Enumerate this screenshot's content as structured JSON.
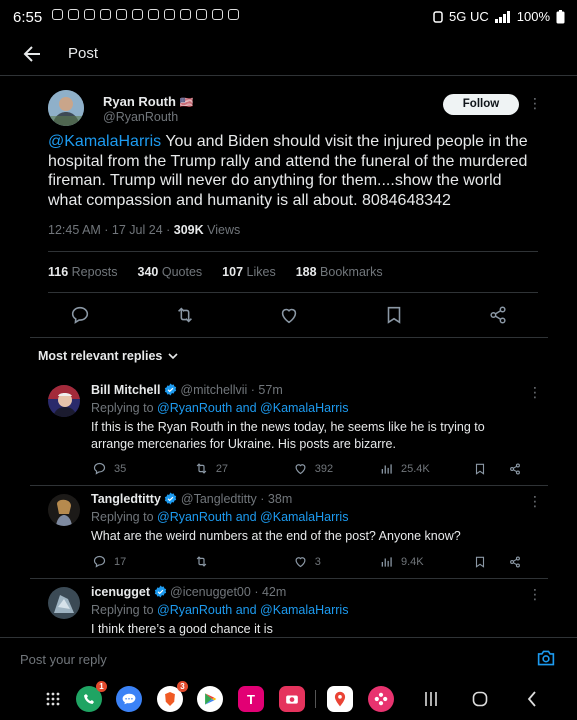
{
  "status_bar": {
    "time": "6:55",
    "network": "5G UC",
    "battery": "100%"
  },
  "header": {
    "title": "Post"
  },
  "post": {
    "author_name": "Ryan Routh",
    "author_flag": "🇺🇸",
    "author_handle": "@RyanRouth",
    "follow_label": "Follow",
    "mention": "@KamalaHarris",
    "text": " You and Biden should visit the injured people in the hospital from the Trump rally and attend the funeral of the murdered fireman. Trump will never do anything for them....show the world what compassion and humanity is all about. 8084648342",
    "time": "12:45 AM · 17 Jul 24 · ",
    "views_count": "309K",
    "views_label": " Views",
    "reposts_count": "116",
    "reposts_label": "Reposts",
    "quotes_count": "340",
    "quotes_label": "Quotes",
    "likes_count": "107",
    "likes_label": "Likes",
    "bookmarks_count": "188",
    "bookmarks_label": "Bookmarks"
  },
  "replies_filter": "Most relevant replies",
  "replies": [
    {
      "name": "Bill Mitchell",
      "handle": "@mitchellvii",
      "age": "· 57m",
      "replying_prefix": "Replying to ",
      "replying_to": "@RyanRouth and @KamalaHarris",
      "text": "If this is the Ryan Routh in the news today, he seems like he is trying to arrange mercenaries for Ukraine. His posts are bizarre.",
      "replies": "35",
      "reposts": "27",
      "likes": "392",
      "views": "25.4K"
    },
    {
      "name": "Tangledtitty",
      "handle": "@Tangledtitty",
      "age": "· 38m",
      "replying_prefix": "Replying to ",
      "replying_to": "@RyanRouth and @KamalaHarris",
      "text": "What are the weird numbers at the end of the post? Anyone know?",
      "replies": "17",
      "reposts": "",
      "likes": "3",
      "views": "9.4K"
    },
    {
      "name": "icenugget",
      "handle": "@icenugget00",
      "age": "· 42m",
      "replying_prefix": "Replying to ",
      "replying_to": "@RyanRouth and @KamalaHarris",
      "text": "I think there’s a good chance it is"
    }
  ],
  "composer": {
    "placeholder": "Post your reply"
  },
  "nav_apps": {
    "phone_badge": "1",
    "brave_badge": "3",
    "tmobile_letter": "T"
  },
  "colors": {
    "accent": "#1d9bf0",
    "background": "#000000",
    "text_primary": "#e7e9ea",
    "text_secondary": "#71767b",
    "divider": "#2f3336"
  }
}
